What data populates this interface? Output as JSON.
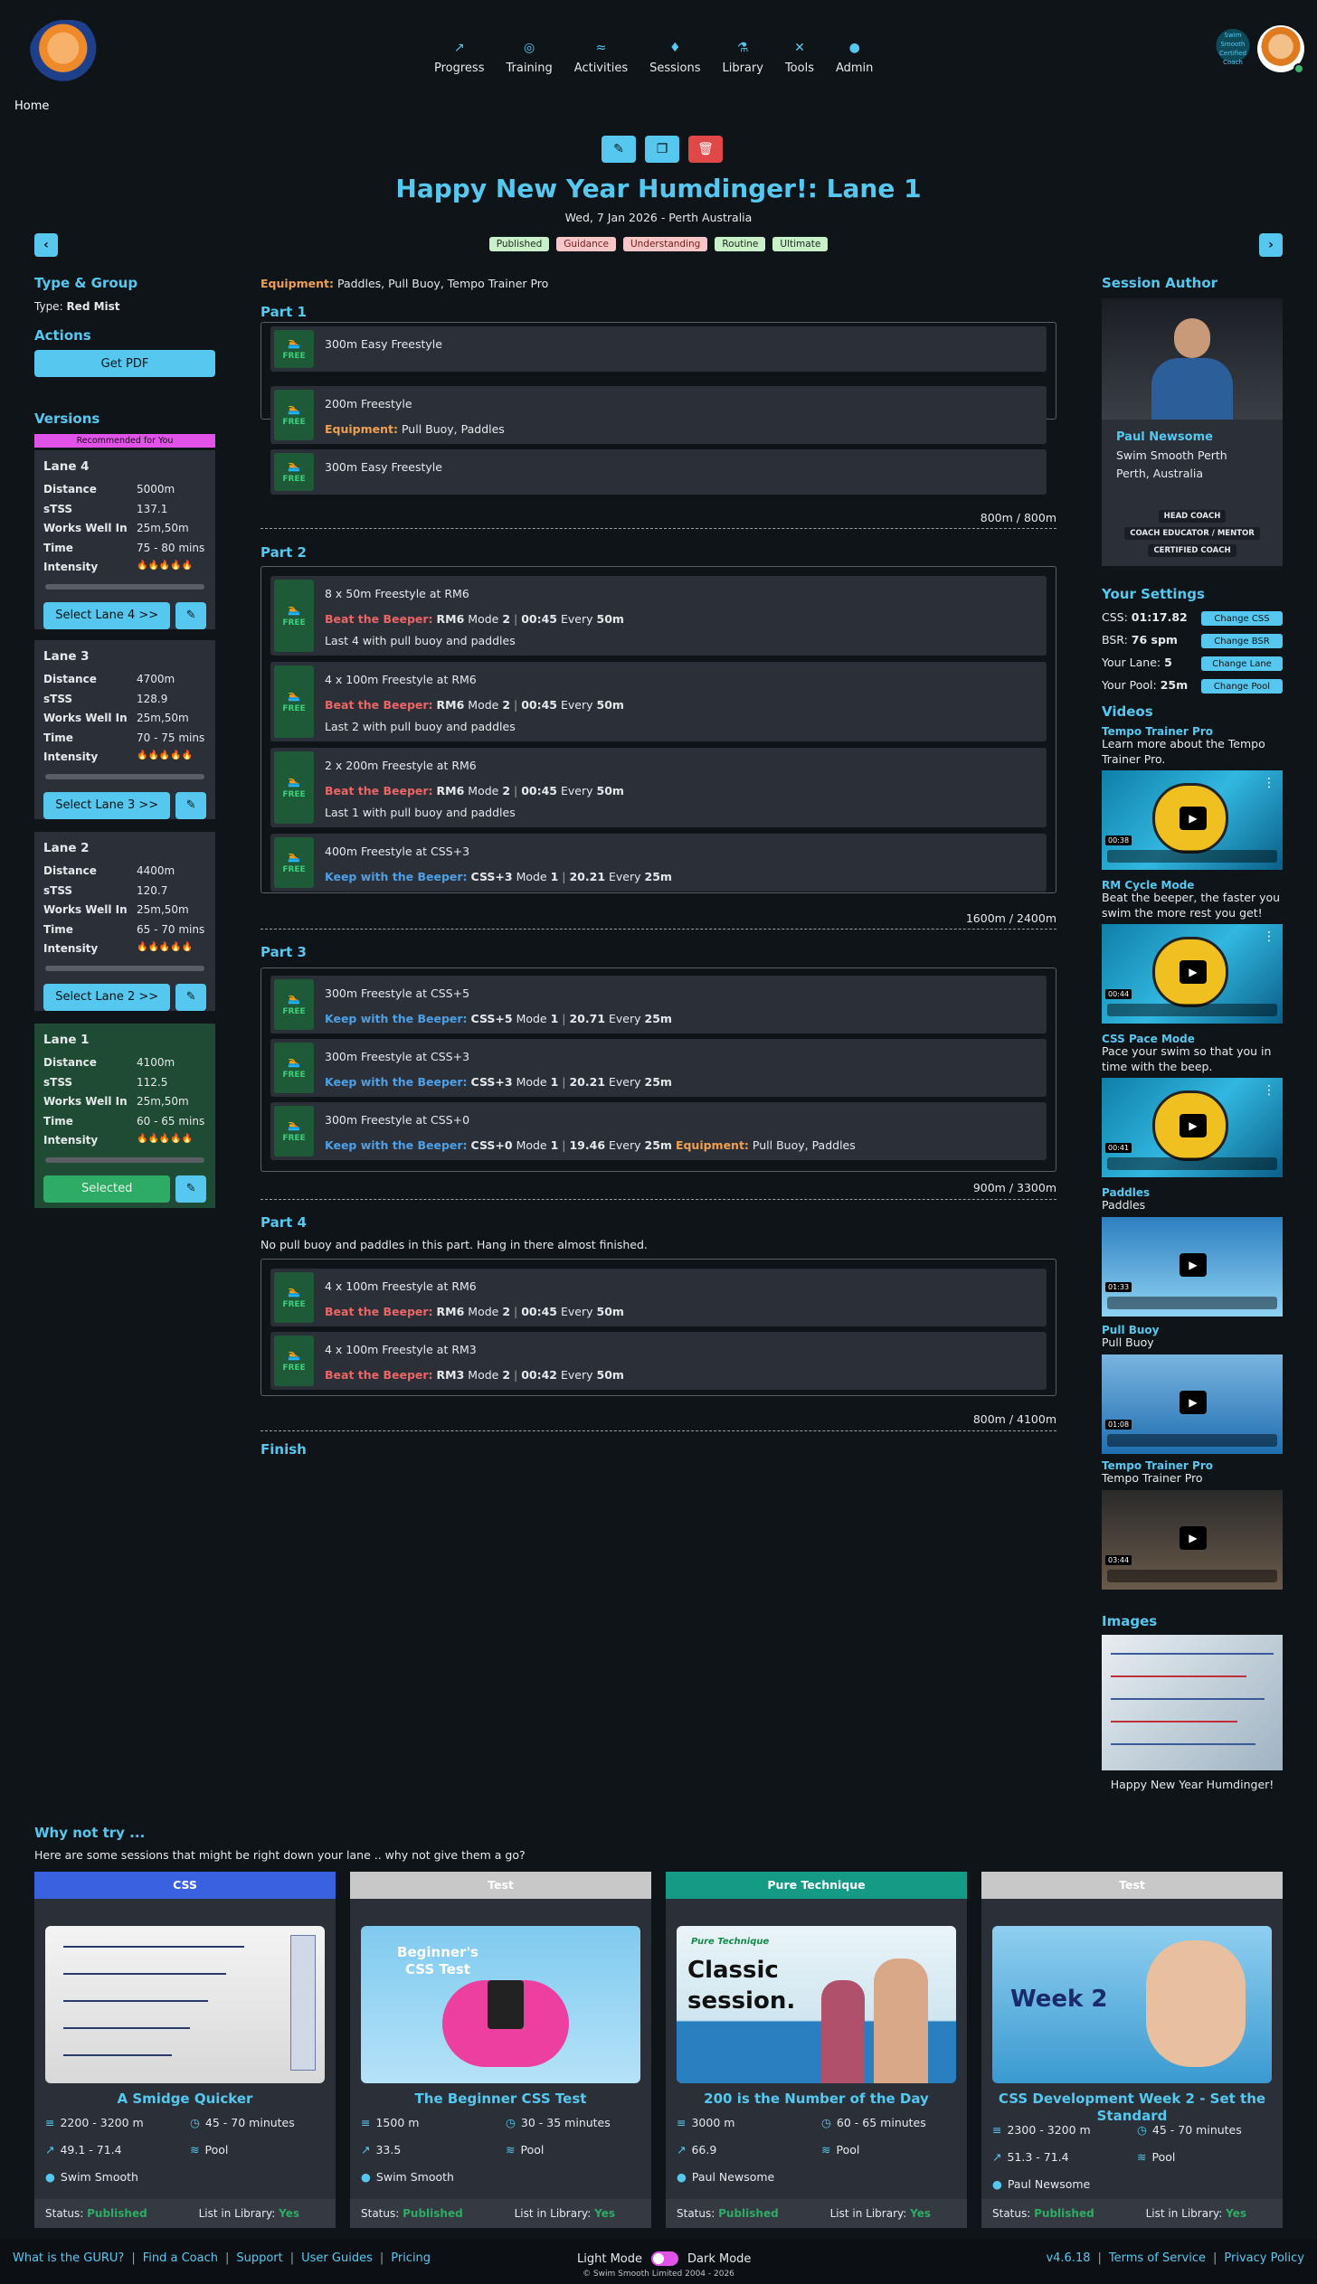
{
  "nav": {
    "items": [
      {
        "label": "Progress",
        "icon": "chart-line-icon",
        "glyph": "↗"
      },
      {
        "label": "Training",
        "icon": "target-icon",
        "glyph": "◎"
      },
      {
        "label": "Activities",
        "icon": "swimmer-icon",
        "glyph": "≈"
      },
      {
        "label": "Sessions",
        "icon": "drop-icon",
        "glyph": "♦"
      },
      {
        "label": "Library",
        "icon": "flask-icon",
        "glyph": "⚗"
      },
      {
        "label": "Tools",
        "icon": "wrench-icon",
        "glyph": "✕"
      },
      {
        "label": "Admin",
        "icon": "user-shield-icon",
        "glyph": "●"
      }
    ],
    "badge_text": "Swim Smooth Certified Coach"
  },
  "breadcrumb": "Home",
  "session": {
    "title": "Happy New Year Humdinger!: Lane 1",
    "subtitle": "Wed, 7 Jan 2026 - Perth Australia",
    "tags": [
      {
        "label": "Published",
        "kind": "g"
      },
      {
        "label": "Guidance",
        "kind": "r"
      },
      {
        "label": "Understanding",
        "kind": "r"
      },
      {
        "label": "Routine",
        "kind": "g"
      },
      {
        "label": "Ultimate",
        "kind": "g"
      }
    ]
  },
  "left": {
    "type_heading": "Type & Group",
    "type_label": "Type:",
    "type_value": "Red Mist",
    "actions_heading": "Actions",
    "pdf_label": "Get PDF",
    "versions_heading": "Versions",
    "recommended": "Recommended for You",
    "row_labels": {
      "distance": "Distance",
      "stss": "sTSS",
      "works": "Works Well In",
      "time": "Time",
      "intensity": "Intensity"
    },
    "lanes": [
      {
        "name": "Lane 4",
        "distance": "5000m",
        "stss": "137.1",
        "works": "25m,50m",
        "time": "75 - 80 mins",
        "intensity": "🔥🔥🔥🔥🔥",
        "button": "Select Lane 4 >>"
      },
      {
        "name": "Lane 3",
        "distance": "4700m",
        "stss": "128.9",
        "works": "25m,50m",
        "time": "70 - 75 mins",
        "intensity": "🔥🔥🔥🔥🔥",
        "button": "Select Lane 3 >>"
      },
      {
        "name": "Lane 2",
        "distance": "4400m",
        "stss": "120.7",
        "works": "25m,50m",
        "time": "65 - 70 mins",
        "intensity": "🔥🔥🔥🔥🔥",
        "button": "Select Lane 2 >>"
      },
      {
        "name": "Lane 1",
        "distance": "4100m",
        "stss": "112.5",
        "works": "25m,50m",
        "time": "60 - 65 mins",
        "intensity": "🔥🔥🔥🔥🔥",
        "button": "Selected"
      }
    ]
  },
  "main": {
    "equipment_label": "Equipment:",
    "equipment": "Paddles, Pull Buoy, Tempo Trainer Pro",
    "free": "FREE",
    "bb_label": "Beat the Beeper:",
    "kb_label": "Keep with the Beeper:",
    "parts": [
      {
        "title": "Part 1",
        "total": "800m / 800m",
        "sets": [
          {
            "t": "300m Easy Freestyle"
          },
          {
            "t": "200m Freestyle",
            "eq": "Pull Buoy, Paddles"
          },
          {
            "t": "300m Easy Freestyle"
          }
        ]
      },
      {
        "title": "Part 2",
        "total": "1600m / 2400m",
        "sets": [
          {
            "t": "8 x 50m Freestyle at RM6",
            "beep": "bb",
            "pace": "RM6",
            "mode": "Mode",
            "mn": "2",
            "time": "00:45",
            "every": "Every",
            "ev": "50m",
            "note": "Last 4 with pull buoy and paddles"
          },
          {
            "t": "4 x 100m Freestyle at RM6",
            "beep": "bb",
            "pace": "RM6",
            "mode": "Mode",
            "mn": "2",
            "time": "00:45",
            "every": "Every",
            "ev": "50m",
            "note": "Last 2 with pull buoy and paddles"
          },
          {
            "t": "2 x 200m Freestyle at RM6",
            "beep": "bb",
            "pace": "RM6",
            "mode": "Mode",
            "mn": "2",
            "time": "00:45",
            "every": "Every",
            "ev": "50m",
            "note": "Last 1 with pull buoy and paddles"
          },
          {
            "t": "400m Freestyle at CSS+3",
            "beep": "kb",
            "pace": "CSS+3",
            "mode": "Mode",
            "mn": "1",
            "time": "20.21",
            "every": "Every",
            "ev": "25m"
          }
        ]
      },
      {
        "title": "Part 3",
        "total": "900m / 3300m",
        "sets": [
          {
            "t": "300m Freestyle at CSS+5",
            "beep": "kb",
            "pace": "CSS+5",
            "mode": "Mode",
            "mn": "1",
            "time": "20.71",
            "every": "Every",
            "ev": "25m"
          },
          {
            "t": "300m Freestyle at CSS+3",
            "beep": "kb",
            "pace": "CSS+3",
            "mode": "Mode",
            "mn": "1",
            "time": "20.21",
            "every": "Every",
            "ev": "25m"
          },
          {
            "t": "300m Freestyle at CSS+0",
            "beep": "kb",
            "pace": "CSS+0",
            "mode": "Mode",
            "mn": "1",
            "time": "19.46",
            "every": "Every",
            "ev": "25m",
            "eq": "Pull Buoy, Paddles"
          }
        ]
      },
      {
        "title": "Part 4",
        "note": "No pull buoy and paddles in this part. Hang in there almost finished.",
        "total": "800m / 4100m",
        "sets": [
          {
            "t": "4 x 100m Freestyle at RM6",
            "beep": "bb",
            "pace": "RM6",
            "mode": "Mode",
            "mn": "2",
            "time": "00:45",
            "every": "Every",
            "ev": "50m"
          },
          {
            "t": "4 x 100m Freestyle at RM3",
            "beep": "bb",
            "pace": "RM3",
            "mode": "Mode",
            "mn": "2",
            "time": "00:42",
            "every": "Every",
            "ev": "50m"
          }
        ]
      }
    ],
    "finish": "Finish"
  },
  "right": {
    "author_heading": "Session Author",
    "author_name": "Paul Newsome",
    "author_org": "Swim Smooth Perth",
    "author_loc": "Perth, Australia",
    "author_badges": [
      "HEAD COACH",
      "COACH EDUCATOR / MENTOR",
      "CERTIFIED COACH"
    ],
    "settings_heading": "Your Settings",
    "settings": [
      {
        "label": "CSS:",
        "value": "01:17.82",
        "button": "Change CSS"
      },
      {
        "label": "BSR:",
        "value": "76 spm",
        "button": "Change BSR"
      },
      {
        "label": "Your Lane:",
        "value": "5",
        "button": "Change Lane"
      },
      {
        "label": "Your Pool:",
        "value": "25m",
        "button": "Change Pool"
      }
    ],
    "videos_heading": "Videos",
    "videos": [
      {
        "name": "Tempo Trainer Pro",
        "desc": "Learn more about the Tempo Trainer Pro.",
        "time": "00:38"
      },
      {
        "name": "RM Cycle Mode",
        "desc": "Beat the beeper, the faster you swim the more rest you get!",
        "time": "00:44"
      },
      {
        "name": "CSS Pace Mode",
        "desc": "Pace your swim so that you in time with the beep.",
        "time": "00:41"
      },
      {
        "name": "Paddles",
        "desc": "Paddles",
        "time": "01:33"
      },
      {
        "name": "Pull Buoy",
        "desc": "Pull Buoy",
        "time": "01:08"
      },
      {
        "name": "Tempo Trainer Pro",
        "desc": "Tempo Trainer Pro",
        "time": "03:44"
      }
    ],
    "images_heading": "Images",
    "image_caption": "Happy New Year Humdinger!"
  },
  "suggest": {
    "heading": "Why not try ...",
    "sub": "Here are some sessions that might be right down your lane .. why not give them a go?",
    "status_label": "Status:",
    "library_label": "List in Library:",
    "cards": [
      {
        "cat": "CSS",
        "color": "#3a62e0",
        "title": "A Smidge Quicker",
        "dist": "2200 - 3200 m",
        "time": "45 - 70 minutes",
        "tss": "49.1 - 71.4",
        "pool": "Pool",
        "author": "Swim Smooth",
        "status": "Published",
        "lib": "Yes"
      },
      {
        "cat": "Test",
        "color": "#c8c8c8",
        "title": "The Beginner CSS Test",
        "dist": "1500 m",
        "time": "30 - 35 minutes",
        "tss": "33.5",
        "pool": "Pool",
        "author": "Swim Smooth",
        "status": "Published",
        "lib": "Yes",
        "img_text": "Beginner's CSS Test"
      },
      {
        "cat": "Pure Technique",
        "color": "#159a86",
        "title": "200 is the Number of the Day",
        "dist": "3000 m",
        "time": "60 - 65 minutes",
        "tss": "66.9",
        "pool": "Pool",
        "author": "Paul Newsome",
        "status": "Published",
        "lib": "Yes",
        "img_text": "Classic session.",
        "img_sub": "Pure Technique"
      },
      {
        "cat": "Test",
        "color": "#c8c8c8",
        "title": "CSS Development Week 2 - Set the Standard",
        "dist": "2300 - 3200 m",
        "time": "45 - 70 minutes",
        "tss": "51.3 - 71.4",
        "pool": "Pool",
        "author": "Paul Newsome",
        "status": "Published",
        "lib": "Yes",
        "img_text": "Week 2"
      }
    ]
  },
  "footer": {
    "left": [
      "What is the GURU?",
      "Find a Coach",
      "Support",
      "User Guides",
      "Pricing"
    ],
    "light": "Light Mode",
    "dark": "Dark Mode",
    "copy": "© Swim Smooth Limited 2004 - 2026",
    "right": [
      "v4.6.18",
      "Terms of Service",
      "Privacy Policy"
    ]
  }
}
